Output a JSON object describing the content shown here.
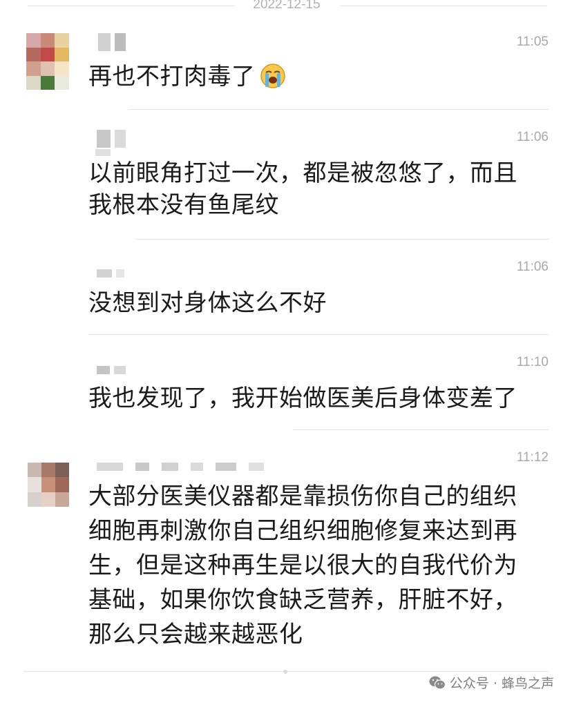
{
  "date_separator": "2022-12-15",
  "messages": [
    {
      "time": "11:05",
      "text": "再也不打肉毒了",
      "emoji": "loudly-crying-face"
    },
    {
      "time": "11:06",
      "text": "以前眼角打过一次，都是被忽悠了，而且我根本没有鱼尾纹"
    },
    {
      "time": "11:06",
      "text": "没想到对身体这么不好"
    },
    {
      "time": "11:10",
      "text": "我也发现了，我开始做医美后身体变差了"
    },
    {
      "time": "11:12",
      "text": "大部分医美仪器都是靠损伤你自己的组织细胞再刺激你自己组织细胞修复来达到再生，但是这种再生是以很大的自我代价为基础，如果你饮食缺乏营养，肝脏不好，那么只会越来越恶化"
    }
  ],
  "watermark": {
    "icon": "wechat-icon",
    "text": "公众号 · 蜂鸟之声"
  }
}
